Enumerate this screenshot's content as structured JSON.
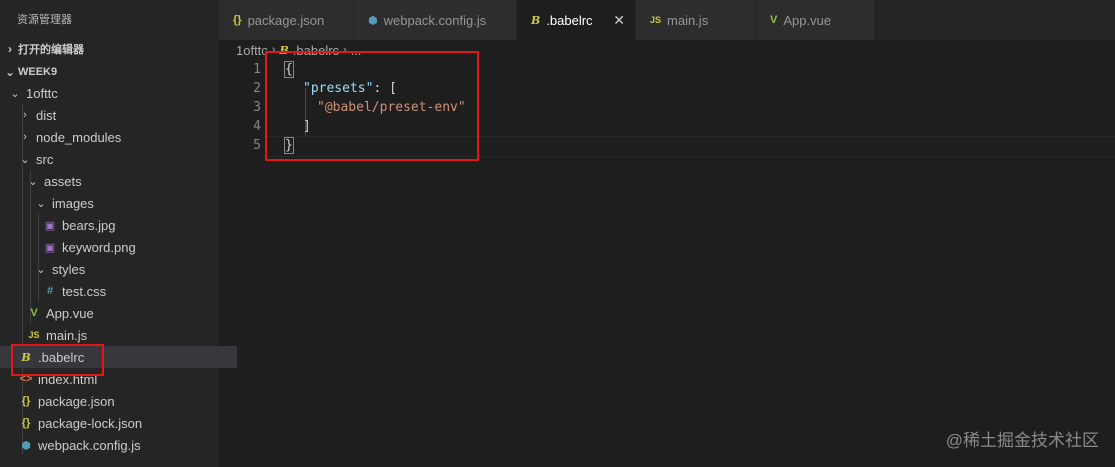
{
  "sidebar": {
    "title": "资源管理器",
    "open_editors": "打开的编辑器",
    "workspace": "WEEK9",
    "tree": [
      {
        "label": "1ofttc",
        "type": "folder"
      },
      {
        "label": "dist",
        "type": "folder"
      },
      {
        "label": "node_modules",
        "type": "folder"
      },
      {
        "label": "src",
        "type": "folder"
      },
      {
        "label": "assets",
        "type": "folder"
      },
      {
        "label": "images",
        "type": "folder"
      },
      {
        "label": "bears.jpg",
        "type": "image"
      },
      {
        "label": "keyword.png",
        "type": "image"
      },
      {
        "label": "styles",
        "type": "folder"
      },
      {
        "label": "test.css",
        "type": "css"
      },
      {
        "label": "App.vue",
        "type": "vue"
      },
      {
        "label": "main.js",
        "type": "js"
      },
      {
        "label": ".babelrc",
        "type": "babel"
      },
      {
        "label": "index.html",
        "type": "html"
      },
      {
        "label": "package.json",
        "type": "json"
      },
      {
        "label": "package-lock.json",
        "type": "json"
      },
      {
        "label": "webpack.config.js",
        "type": "webpack"
      }
    ]
  },
  "tabs": [
    {
      "label": "package.json",
      "icon": "{}"
    },
    {
      "label": "webpack.config.js",
      "icon": "webpack-icon"
    },
    {
      "label": ".babelrc",
      "icon": "babel-icon",
      "active": true
    },
    {
      "label": "main.js",
      "icon": "JS"
    },
    {
      "label": "App.vue",
      "icon": "vue-icon"
    }
  ],
  "breadcrumbs": {
    "folder": "1ofttc",
    "file": ".babelrc",
    "more": "..."
  },
  "editor": {
    "line_numbers": [
      "1",
      "2",
      "3",
      "4",
      "5"
    ],
    "lines": {
      "l1": "{",
      "l2_key": "\"presets\"",
      "l2_rest": ": [",
      "l3": "\"@babel/preset-env\"",
      "l4": "]",
      "l5": "}"
    }
  },
  "watermark": "@稀土掘金技术社区",
  "colors": {
    "accent_red": "#e01818",
    "json_icon": "#cbcb41",
    "vue_icon": "#8dc149",
    "image_icon": "#a074c4",
    "html_icon": "#e37933",
    "css_icon": "#519aba"
  }
}
